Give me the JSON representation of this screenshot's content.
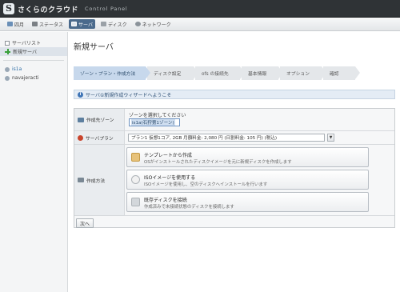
{
  "header": {
    "logo_mark": "S",
    "logo_text": "さくらのクラウド",
    "subtitle": "Control Panel"
  },
  "nav": [
    {
      "label": "四月",
      "icon": "home-icon",
      "active": false
    },
    {
      "label": "ステータス",
      "icon": "status-icon",
      "active": false
    },
    {
      "label": "サーバ",
      "icon": "server-icon",
      "active": true
    },
    {
      "label": "ディスク",
      "icon": "disk-icon",
      "active": false
    },
    {
      "label": "ネットワーク",
      "icon": "network-icon",
      "active": false
    }
  ],
  "sidebar": {
    "items": [
      {
        "label": "サーバリスト"
      },
      {
        "label": "新規サーバ"
      }
    ],
    "zone_label": "is1a",
    "zone_sub": "navajeracti"
  },
  "main": {
    "title": "新規サーバ",
    "steps": [
      "ゾーン・プラン・作成方法",
      "ディスク設定",
      "ofs の接続先",
      "基本情報",
      "オプション",
      "確認"
    ],
    "welcome": "サーバ①新規作成ウィザードへようこそ",
    "zone": {
      "label": "作成先ゾーン",
      "hint": "ゾーンを選択してください",
      "value": "is1a(石狩第1ゾーン)"
    },
    "plan": {
      "label": "サーバプラン",
      "value": "プラン1 仮想1コア, 2GB 月額料金: 2,080 円 (日割料金: 105 円) (税込)"
    },
    "method": {
      "label": "作成方法",
      "options": [
        {
          "title": "テンプレートから作成",
          "desc": "OSがインストールされたディスクイメージを元に新規ディスクを作成します"
        },
        {
          "title": "ISOイメージを使用する",
          "desc": "ISOイメージを使用し、空のディスクへインストールを行います"
        },
        {
          "title": "既存ディスクを接続",
          "desc": "作成済みで未接続状態のディスクを接続します"
        }
      ]
    },
    "next_button": "次へ"
  }
}
